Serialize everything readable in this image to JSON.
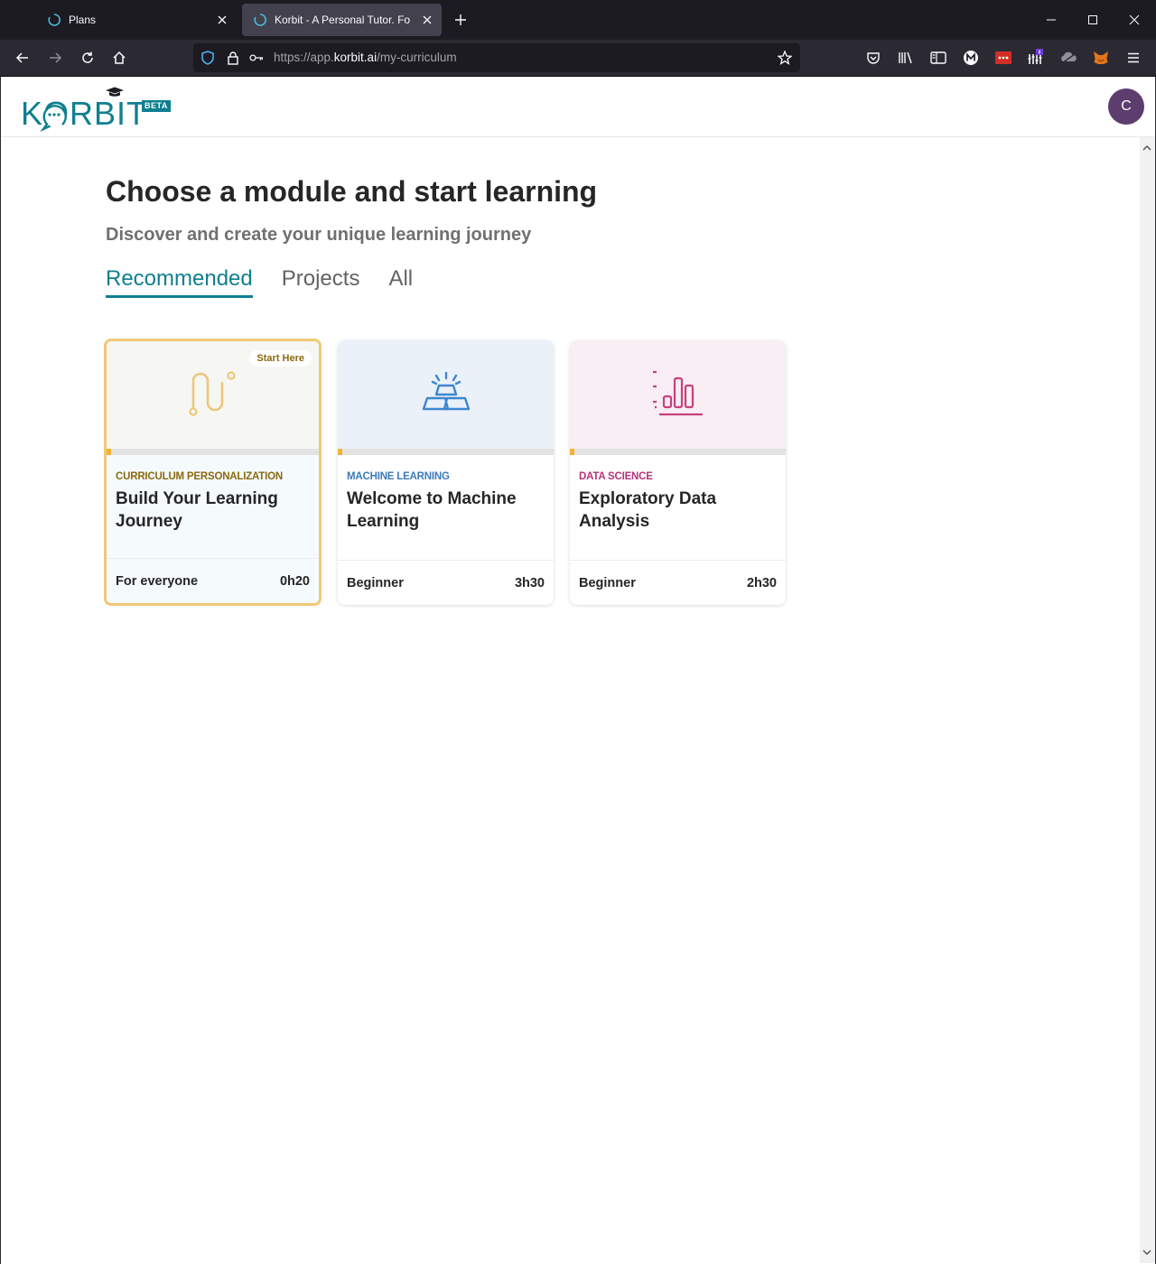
{
  "browser": {
    "tabs": [
      {
        "title": "Plans"
      },
      {
        "title": "Korbit - A Personal Tutor. For Ev"
      }
    ],
    "url_prefix": "https://app.",
    "url_domain": "korbit.ai",
    "url_path": "/my-curriculum"
  },
  "header": {
    "logo_text": "KORBIT",
    "beta_label": "BETA",
    "avatar_initial": "C"
  },
  "main": {
    "title": "Choose a module and start learning",
    "subtitle": "Discover and create your unique learning journey",
    "tabs": [
      {
        "label": "Recommended"
      },
      {
        "label": "Projects"
      },
      {
        "label": "All"
      }
    ],
    "cards": [
      {
        "badge": "Start Here",
        "category": "CURRICULUM PERSONALIZATION",
        "title": "Build Your Learning Journey",
        "level": "For everyone",
        "duration": "0h20",
        "progress": 0.02,
        "icon": "path-icon",
        "colors": {
          "category": "#8a6a10",
          "media_bg": "#f6f6f3",
          "body_bg": "#f5fafc"
        }
      },
      {
        "category": "MACHINE LEARNING",
        "title": "Welcome to Machine Learning",
        "level": "Beginner",
        "duration": "3h30",
        "progress": 0.02,
        "icon": "gold-bars-icon",
        "colors": {
          "category": "#3d7ab8",
          "media_bg": "#ebf1f9",
          "body_bg": "#ffffff"
        }
      },
      {
        "category": "DATA SCIENCE",
        "title": "Exploratory Data Analysis",
        "level": "Beginner",
        "duration": "2h30",
        "progress": 0.02,
        "icon": "bar-chart-icon",
        "colors": {
          "category": "#b8337a",
          "media_bg": "#f9eef3",
          "body_bg": "#ffffff"
        }
      }
    ]
  }
}
